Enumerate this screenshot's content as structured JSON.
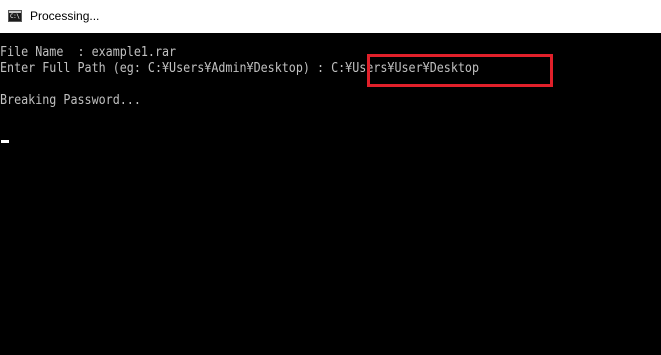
{
  "window": {
    "title": "Processing...",
    "icon": "console-icon",
    "icon_glyph": "C:\\"
  },
  "console": {
    "file_name_label": "File Name  : ",
    "file_name_value": "example1.rar",
    "path_prompt": "Enter Full Path (eg: C:¥Users¥Admin¥Desktop) : ",
    "path_value": "C:¥Users¥User¥Desktop",
    "status": "Breaking Password..."
  },
  "colors": {
    "background": "#000000",
    "text": "#c0c0c0",
    "highlight_border": "#e0202a",
    "titlebar": "#ffffff"
  }
}
